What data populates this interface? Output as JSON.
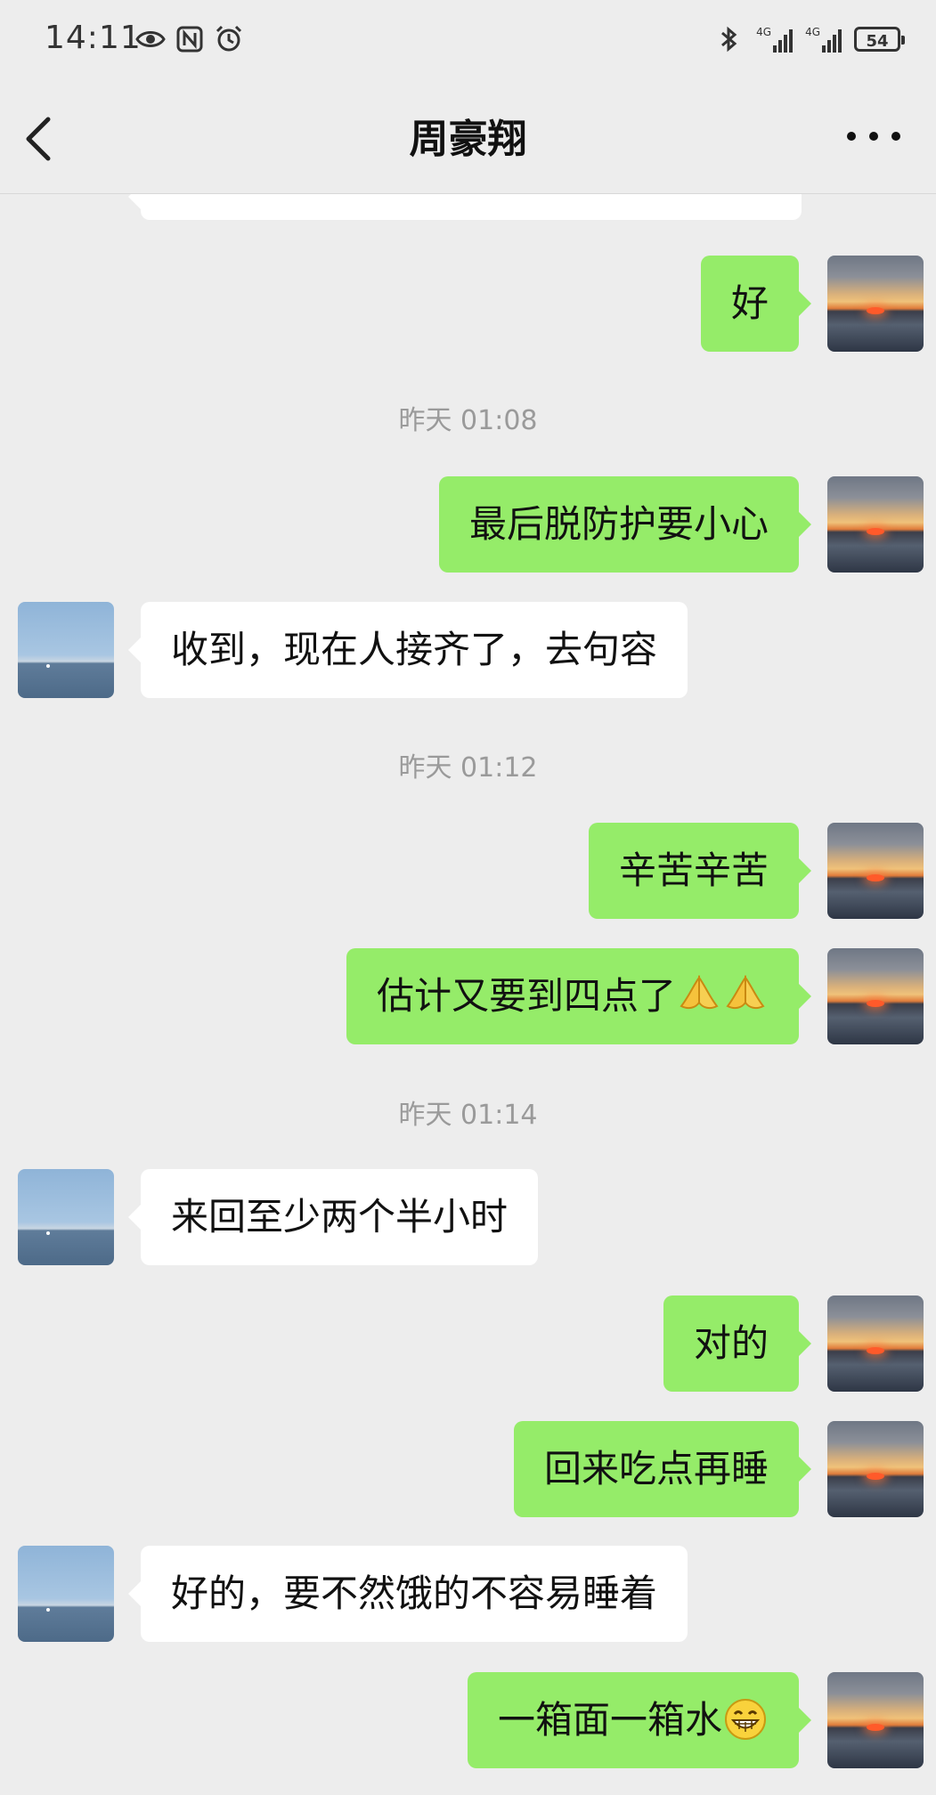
{
  "status_bar": {
    "time": "14:11",
    "battery": "54",
    "left_icons": [
      "eye-icon",
      "nfc-icon",
      "alarm-icon"
    ],
    "right_icons": [
      "bluetooth-icon",
      "signal-4g-icon",
      "signal-4g-icon",
      "battery-icon"
    ]
  },
  "header": {
    "title": "周豪翔",
    "back_icon": "back-chevron-icon",
    "more_icon": "more-dots-icon"
  },
  "colors": {
    "background": "#ededed",
    "outgoing_bubble": "#95ec69",
    "incoming_bubble": "#ffffff",
    "timestamp": "#9a9a9a"
  },
  "messages": [
    {
      "type": "partial_in",
      "text": ""
    },
    {
      "type": "out",
      "text": "好"
    },
    {
      "type": "time",
      "text": "昨天 01:08"
    },
    {
      "type": "out",
      "text": "最后脱防护要小心"
    },
    {
      "type": "in",
      "text": "收到，现在人接齐了，去句容"
    },
    {
      "type": "time",
      "text": "昨天 01:12"
    },
    {
      "type": "out",
      "text": "辛苦辛苦"
    },
    {
      "type": "out",
      "text": "估计又要到四点了",
      "emoji": [
        "pray-icon",
        "pray-icon"
      ]
    },
    {
      "type": "time",
      "text": "昨天 01:14"
    },
    {
      "type": "in",
      "text": "来回至少两个半小时"
    },
    {
      "type": "out",
      "text": "对的"
    },
    {
      "type": "out",
      "text": "回来吃点再睡"
    },
    {
      "type": "in",
      "text": "好的，要不然饿的不容易睡着"
    },
    {
      "type": "out",
      "text": "一箱面一箱水",
      "emoji": [
        "grin-icon"
      ]
    }
  ]
}
